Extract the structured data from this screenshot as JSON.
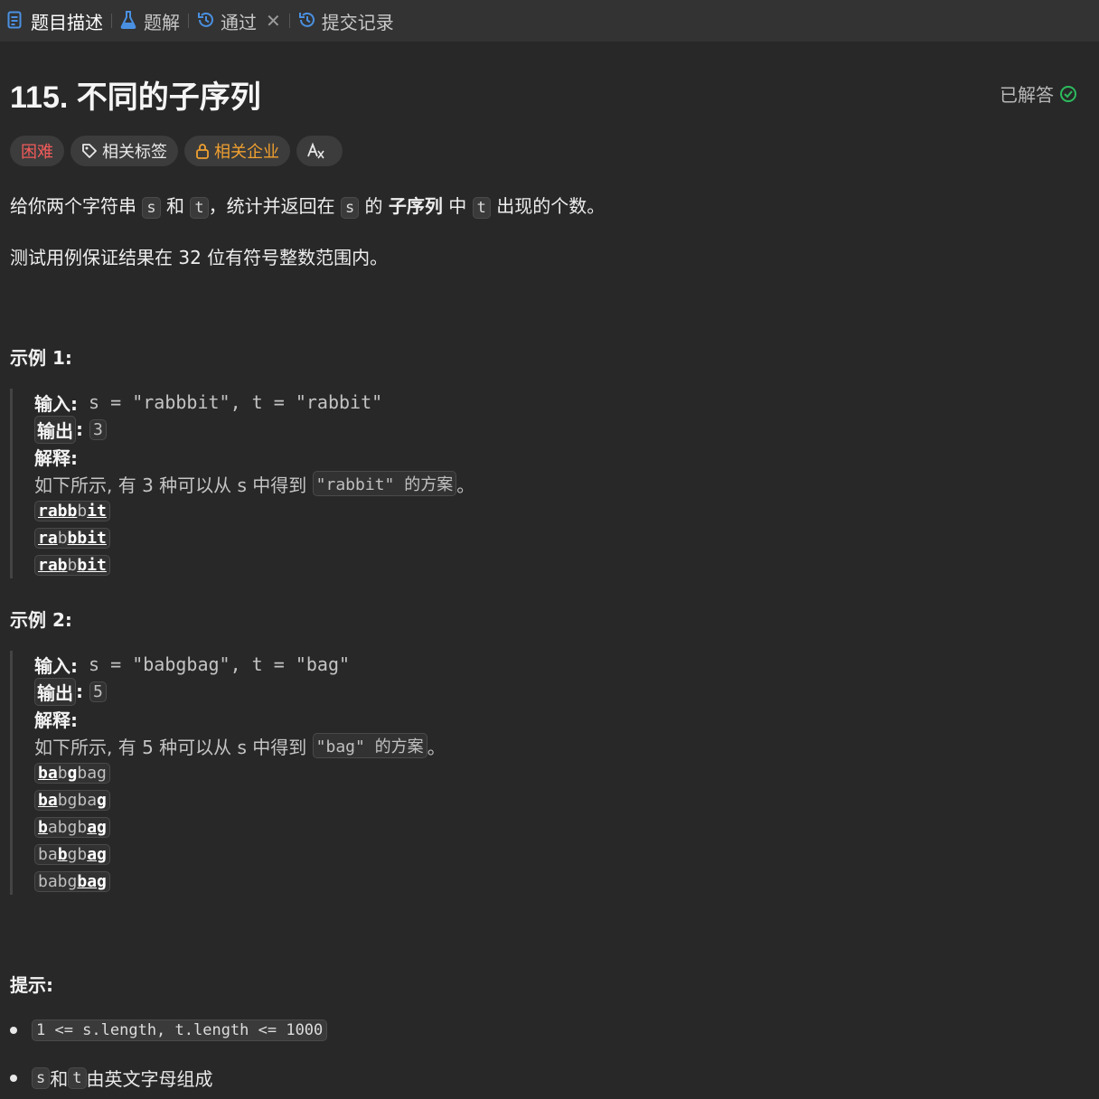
{
  "tabs": [
    {
      "label": "题目描述",
      "icon": "description-icon",
      "color": "#4a90e2"
    },
    {
      "label": "题解",
      "icon": "flask-icon",
      "color": "#4a90e2"
    },
    {
      "label": "通过",
      "icon": "history-icon",
      "color": "#4a90e2",
      "close": "✕"
    },
    {
      "label": "提交记录",
      "icon": "history-icon",
      "color": "#4a90e2"
    }
  ],
  "problem": {
    "title": "115. 不同的子序列",
    "status": "已解答",
    "status_color": "#2cbb5d"
  },
  "chips": {
    "difficulty": "困难",
    "tags": "相关标签",
    "companies": "相关企业"
  },
  "description": {
    "p1": [
      "给你两个字符串 ",
      "s",
      " 和 ",
      "t",
      "，统计并返回在 ",
      "s",
      " 的 ",
      "子序列",
      " 中 ",
      "t",
      " 出现的个数。"
    ],
    "p2": "测试用例保证结果在 32 位有符号整数范围内。"
  },
  "examples": [
    {
      "heading": "示例 1:",
      "input_label": "输入:",
      "input": " s = \"rabbbit\", t = \"rabbit\"",
      "output_label": "输出",
      "output": "3",
      "explain_label": "解释:",
      "explain_a": "如下所示, 有 3 种可以从 s 中得到 ",
      "explain_code": "\"rabbit\" 的方案",
      "explain_b": "。",
      "rows": [
        [
          {
            "t": "rabb",
            "b": true
          },
          {
            "t": "b",
            "b": false
          },
          {
            "t": "it",
            "b": true
          }
        ],
        [
          {
            "t": "ra",
            "b": true
          },
          {
            "t": "b",
            "b": false
          },
          {
            "t": "bbit",
            "b": true
          }
        ],
        [
          {
            "t": "rab",
            "b": true
          },
          {
            "t": "b",
            "b": false
          },
          {
            "t": "bit",
            "b": true
          }
        ]
      ]
    },
    {
      "heading": "示例 2:",
      "input_label": "输入:",
      "input": " s = \"babgbag\", t = \"bag\"",
      "output_label": "输出",
      "output": "5",
      "explain_label": "解释:",
      "explain_a": "如下所示, 有 5 种可以从 s 中得到 ",
      "explain_code": "\"bag\" 的方案",
      "explain_b": "。",
      "rows": [
        [
          {
            "t": "ba",
            "b": true
          },
          {
            "t": "b",
            "b": false
          },
          {
            "t": "g",
            "b": true
          },
          {
            "t": "bag",
            "b": false
          }
        ],
        [
          {
            "t": "ba",
            "b": true
          },
          {
            "t": "bgba",
            "b": false
          },
          {
            "t": "g",
            "b": true
          }
        ],
        [
          {
            "t": "b",
            "b": true
          },
          {
            "t": "abgb",
            "b": false
          },
          {
            "t": "ag",
            "b": true
          }
        ],
        [
          {
            "t": "ba",
            "b": false
          },
          {
            "t": "b",
            "b": true
          },
          {
            "t": "gb",
            "b": false
          },
          {
            "t": "ag",
            "b": true
          }
        ],
        [
          {
            "t": "babg",
            "b": false
          },
          {
            "t": "bag",
            "b": true
          }
        ]
      ]
    }
  ],
  "hints": {
    "heading": "提示:",
    "c1": "1 <= s.length, t.length <= 1000",
    "c2_code1": "s",
    "c2_mid": " 和 ",
    "c2_code2": "t",
    "c2_text": " 由英文字母组成"
  }
}
